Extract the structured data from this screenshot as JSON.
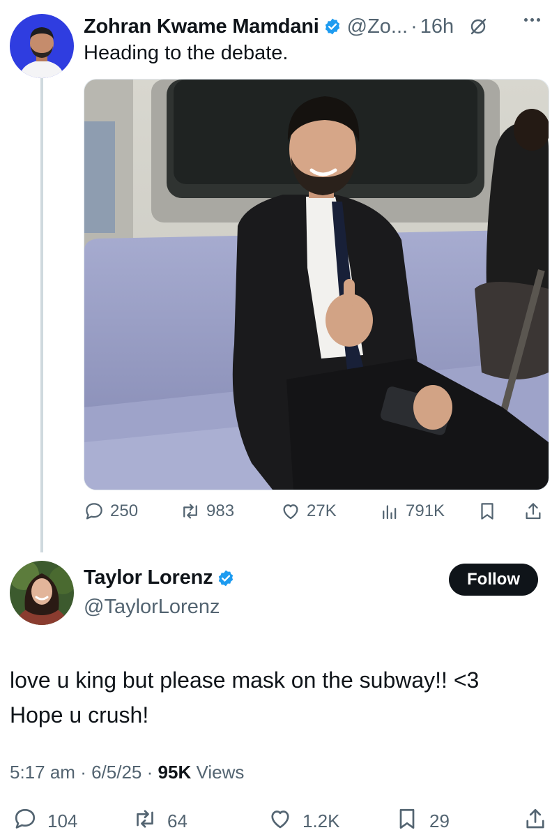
{
  "tweet": {
    "author_name": "Zohran Kwame Mamdani",
    "handle": "@Zo...",
    "separator": "·",
    "time": "16h",
    "text": "Heading to the debate.",
    "stats": {
      "replies": "250",
      "reposts": "983",
      "likes": "27K",
      "views": "791K"
    },
    "icons": [
      "verified-badge-icon",
      "grok-icon",
      "more-icon",
      "reply-icon",
      "repost-icon",
      "like-icon",
      "views-icon",
      "bookmark-icon",
      "share-icon"
    ]
  },
  "reply": {
    "author_name": "Taylor Lorenz",
    "handle": "@TaylorLorenz",
    "follow_label": "Follow",
    "text_line1": "love u king but please mask on the subway!! <3",
    "text_line2": "Hope u crush!",
    "time": "5:17 am",
    "date": "6/5/25",
    "separator": "·",
    "views_count": "95K",
    "views_label": "Views",
    "stats": {
      "replies": "104",
      "reposts": "64",
      "likes": "1.2K",
      "bookmarks": "29"
    }
  },
  "colors": {
    "verified_blue": "#1d9bf0",
    "secondary_text": "#536471",
    "primary_text": "#0f1419",
    "avatar_bg": "#2f3de0",
    "seat_color": "#9da3c8"
  }
}
